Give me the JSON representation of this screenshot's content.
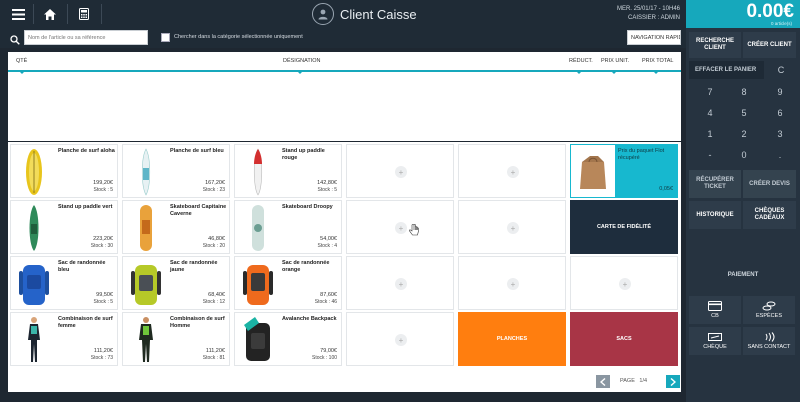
{
  "header": {
    "client_name": "Client Caisse",
    "date_line": "MER. 25/01/17 - 10H46",
    "cashier_line": "CAISSIER : ADMIN"
  },
  "search": {
    "placeholder": "Nom de l'article ou sa référence",
    "checkbox_label": "Chercher dans la catégorie sélectionnée uniquement",
    "nav_button": "NAVIGATION RAPIDE"
  },
  "ticket": {
    "columns": {
      "qty": "QTÉ",
      "designation": "DÉSIGNATION",
      "discount": "RÉDUCT.",
      "unit_price": "PRIX UNIT.",
      "total_price": "PRIX TOTAL"
    }
  },
  "products": [
    {
      "name": "Planche de surf aloha",
      "price": "199,20€",
      "stock": "Stock : 5"
    },
    {
      "name": "Planche de surf bleu",
      "price": "167,20€",
      "stock": "Stock : 23"
    },
    {
      "name": "Stand up paddle rouge",
      "price": "142,80€",
      "stock": "Stock : 5"
    },
    {
      "name": "Stand up paddle vert",
      "price": "223,20€",
      "stock": "Stock : 30"
    },
    {
      "name": "Skateboard Capitaine Caverne",
      "price": "46,80€",
      "stock": "Stock : 20"
    },
    {
      "name": "Skateboard Droopy",
      "price": "54,00€",
      "stock": "Stock : 4"
    },
    {
      "name": "Sac de randonnée bleu",
      "price": "99,50€",
      "stock": "Stock : 5"
    },
    {
      "name": "Sac de randonnée jaune",
      "price": "68,40€",
      "stock": "Stock : 12"
    },
    {
      "name": "Sac de randonnée orange",
      "price": "87,60€",
      "stock": "Stock : 46"
    },
    {
      "name": "Combinaison de surf femme",
      "price": "111,20€",
      "stock": "Stock : 73"
    },
    {
      "name": "Combinaison de surf Homme",
      "price": "111,20€",
      "stock": "Stock : 81"
    },
    {
      "name": "Avalanche Backpack",
      "price": "79,00€",
      "stock": "Stock : 100"
    }
  ],
  "special_tiles": {
    "bag_fee": {
      "name": "Prix du paquet Flot récupéré",
      "price": "0,05€"
    },
    "loyalty_card": "CARTE DE FIDÉLITÉ",
    "category_planches": "PLANCHES",
    "category_sacs": "SACS"
  },
  "pagination": {
    "label": "PAGE",
    "current": "1",
    "total": "4"
  },
  "panel": {
    "total": "0.00€",
    "total_sub": "0 article(s)",
    "search_client": "RECHERCHE CLIENT",
    "create_client": "CRÉER CLIENT",
    "clear_cart": "EFFACER LE PANIER",
    "clear_key": "C",
    "keys": [
      "7",
      "8",
      "9",
      "4",
      "5",
      "6",
      "1",
      "2",
      "3",
      "-",
      "0",
      "."
    ],
    "recover_ticket": "RÉCUPÉRER TICKET",
    "create_quote": "CRÉER DEVIS",
    "history": "HISTORIQUE",
    "gift_vouchers": "CHÈQUES CADEAUX",
    "payment": "PAIEMENT",
    "pay_card": "CB",
    "pay_cash": "ESPÈCES",
    "pay_cheque": "CHÈQUE",
    "pay_contactless": "SANS CONTACT"
  }
}
